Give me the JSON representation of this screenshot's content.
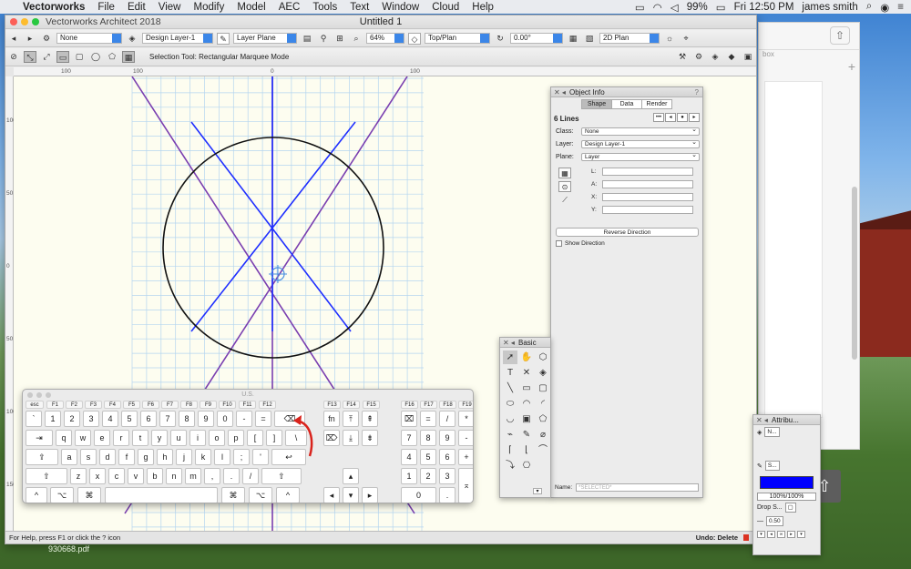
{
  "colors": {
    "accent": "#3b86e8",
    "line_blue": "#1f2fff",
    "line_purple": "#7a3fb0",
    "grid": "#b4d5ef",
    "canvas_bg": "#fdfdf0",
    "fill_swatch": "#0000ff"
  },
  "menubar": {
    "app": "Vectorworks",
    "items": [
      "File",
      "Edit",
      "View",
      "Modify",
      "Model",
      "AEC",
      "Tools",
      "Text",
      "Window",
      "Cloud",
      "Help"
    ],
    "battery": "99%",
    "clock": "Fri 12:50 PM",
    "user": "james smith"
  },
  "window": {
    "app_title": "Vectorworks Architect 2018",
    "doc_title": "Untitled 1"
  },
  "toolbar1": {
    "class": "None",
    "layer": "Design Layer-1",
    "plane": "Layer Plane",
    "zoom": "64%",
    "view": "Top/Plan",
    "rotation": "0.00°",
    "render": "2D Plan"
  },
  "toolbar2": {
    "mode": "Selection Tool: Rectangular Marquee Mode"
  },
  "rulers": {
    "h": [
      "100",
      "0",
      "100"
    ],
    "v": [
      "100",
      "50",
      "0",
      "50",
      "100",
      "150"
    ]
  },
  "status": {
    "help": "For Help, press F1 or click the ? icon",
    "undo": "Undo: Delete"
  },
  "object_info": {
    "title": "Object Info",
    "tabs": [
      "Shape",
      "Data",
      "Render"
    ],
    "selection": "6 Lines",
    "nav": [
      "•••",
      "◂",
      "●",
      "▸"
    ],
    "class_label": "Class:",
    "class_value": "None",
    "layer_label": "Layer:",
    "layer_value": "Design Layer-1",
    "plane_label": "Plane:",
    "plane_value": "Layer",
    "coords": [
      "L:",
      "A:",
      "X:",
      "Y:"
    ],
    "reverse": "Reverse Direction",
    "show_direction": "Show Direction",
    "name_label": "Name:",
    "name_placeholder": "*SELECTED*"
  },
  "basic": {
    "title": "Basic",
    "tools": [
      "➚",
      "✋",
      "⬡",
      "T",
      "✕",
      "◈",
      "╲",
      "▭",
      "▢",
      "⬭",
      "◠",
      "◜",
      "◡",
      "▣",
      "⬠",
      "⌁",
      "✎",
      "⌀",
      "⌈",
      "⌊",
      "⌒",
      "⤵",
      "⎔",
      ""
    ]
  },
  "attributes": {
    "title": "Attribu...",
    "fill": "N...",
    "pen": "S...",
    "opacity": "100%/100%",
    "shadow": "Drop S...",
    "weight": "0.50"
  },
  "keyboard": {
    "title": "U.S.",
    "fkeys": [
      "esc",
      "F1",
      "F2",
      "F3",
      "F4",
      "F5",
      "F6",
      "F7",
      "F8",
      "F9",
      "F10",
      "F11",
      "F12",
      "F13",
      "F14",
      "F15",
      "F16",
      "F17",
      "F18",
      "F19"
    ],
    "row1": [
      "`",
      "1",
      "2",
      "3",
      "4",
      "5",
      "6",
      "7",
      "8",
      "9",
      "0",
      "-",
      "=",
      "⌫"
    ],
    "row2": [
      "⇥",
      "q",
      "w",
      "e",
      "r",
      "t",
      "y",
      "u",
      "i",
      "o",
      "p",
      "[",
      "]",
      "\\"
    ],
    "row3": [
      "⇪",
      "a",
      "s",
      "d",
      "f",
      "g",
      "h",
      "j",
      "k",
      "l",
      ";",
      "'",
      "↩"
    ],
    "row4": [
      "⇧",
      "z",
      "x",
      "c",
      "v",
      "b",
      "n",
      "m",
      ",",
      ".",
      "/",
      "⇧"
    ],
    "row5": [
      "^",
      "⌥",
      "⌘",
      "",
      "⌘",
      "⌥",
      "^"
    ],
    "nav1": [
      "fn",
      "⤒",
      "⇞"
    ],
    "nav2": [
      "⌦",
      "⤓",
      "⇟"
    ],
    "arrows": [
      "▴",
      "◂",
      "▾",
      "▸"
    ],
    "pad1": [
      "⌧",
      "=",
      "/",
      "*"
    ],
    "pad2": [
      "7",
      "8",
      "9",
      "-"
    ],
    "pad3": [
      "4",
      "5",
      "6",
      "+"
    ],
    "pad4": [
      "1",
      "2",
      "3",
      "⌅"
    ],
    "pad5": [
      "0",
      "."
    ]
  },
  "desktop": {
    "file_label": "930668.pdf",
    "bg_label": "box"
  }
}
